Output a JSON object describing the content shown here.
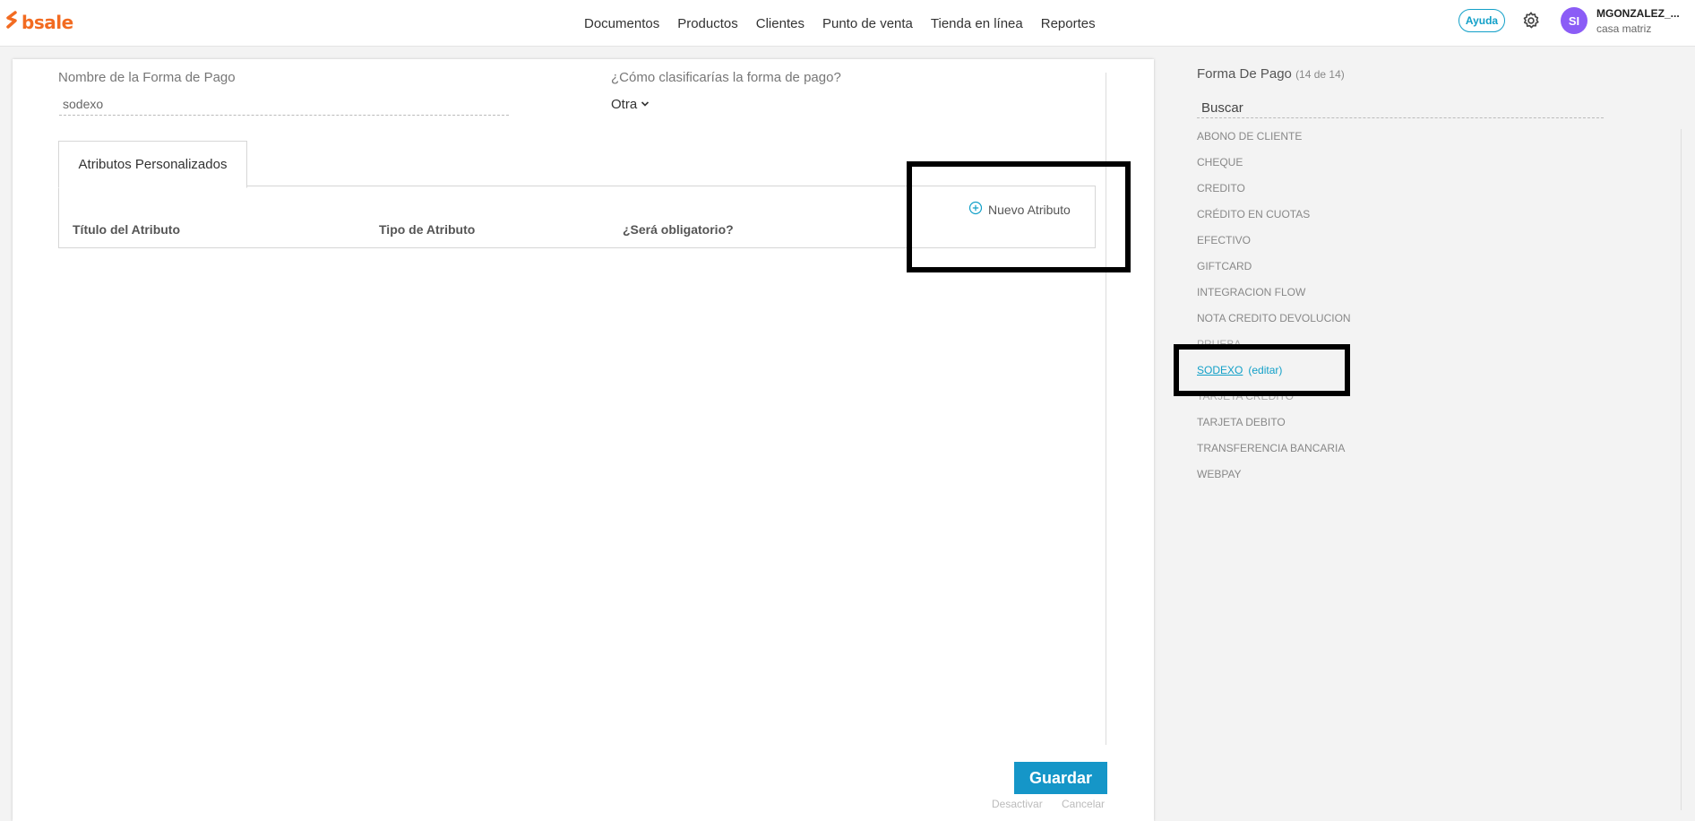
{
  "brand": {
    "logo_text": "bsale",
    "color": "#f26b21"
  },
  "nav": [
    "Documentos",
    "Productos",
    "Clientes",
    "Punto de venta",
    "Tienda en línea",
    "Reportes"
  ],
  "header": {
    "help_label": "Ayuda",
    "avatar_initials": "SI",
    "user_name": "MGONZALEZ_...",
    "user_branch": "casa matriz"
  },
  "form": {
    "name_label": "Nombre de la Forma de Pago",
    "name_value": "sodexo",
    "classify_label": "¿Cómo clasificarías la forma de pago?",
    "classify_value": "Otra",
    "tab_label": "Atributos Personalizados",
    "columns": [
      "Título del Atributo",
      "Tipo de Atributo",
      "¿Será obligatorio?"
    ],
    "new_attribute_label": "Nuevo Atributo",
    "save_label": "Guardar",
    "deactivate_label": "Desactivar",
    "cancel_label": "Cancelar"
  },
  "sidebar": {
    "title": "Forma De Pago",
    "count": "(14 de 14)",
    "search_placeholder": "Buscar",
    "edit_label": "(editar)",
    "items": [
      "ABONO DE CLIENTE",
      "CHEQUE",
      "CREDITO",
      "CRÉDITO EN CUOTAS",
      "EFECTIVO",
      "GIFTCARD",
      "INTEGRACION FLOW",
      "NOTA CREDITO DEVOLUCION",
      "PRUEBA",
      "SODEXO",
      "TARJETA CREDITO",
      "TARJETA DEBITO",
      "TRANSFERENCIA BANCARIA",
      "WEBPAY"
    ],
    "selected_index": 9
  },
  "colors": {
    "accent": "#1596c8",
    "avatar": "#8b5cf6"
  }
}
